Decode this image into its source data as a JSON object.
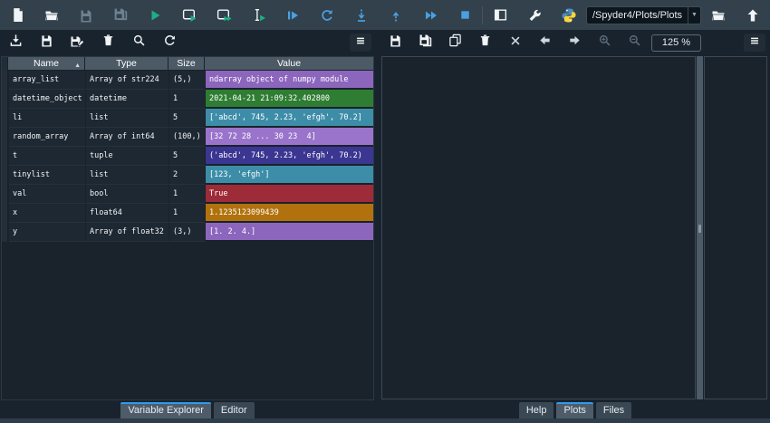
{
  "main_toolbar": {
    "buttons": [
      "new-file",
      "open-file",
      "save",
      "save-all",
      "run",
      "run-cell",
      "run-cell-advance",
      "run-selection",
      "debug-file",
      "rerun",
      "step-into",
      "step-return",
      "continue",
      "stop",
      "maximize-pane",
      "preferences",
      "python-interpreter",
      "open-directory",
      "parent-directory"
    ],
    "path_value": "/Spyder4/Plots/Plots",
    "dropdown_arrow": "▼"
  },
  "icons": {
    "new-file": "📄",
    "open-file": "📁",
    "save": "💾",
    "save-all": "💾",
    "run": "▶",
    "stop": "■",
    "search": "🔍",
    "refresh": "⟳",
    "menu": "☰",
    "trash": "🗑",
    "copy": "⧉",
    "close": "✕",
    "prev-plot": "←",
    "next-plot": "→",
    "zoom-in": "🔍+",
    "zoom-out": "🔍−",
    "import-data": "⤓",
    "up-arrow": "⬆",
    "wrench": "🔧",
    "python": "🐍"
  },
  "variable_explorer": {
    "toolbar": [
      "import-data",
      "save-data",
      "save-data-as",
      "remove-variables",
      "search",
      "refresh",
      "options-menu"
    ],
    "headers": {
      "name": "Name",
      "type": "Type",
      "size": "Size",
      "value": "Value"
    },
    "sort_indicator": "▲",
    "rows": [
      {
        "name": "array_list",
        "type": "Array of str224",
        "size": "(5,)",
        "value": "ndarray object of numpy module",
        "value_bg": "#8c66bd"
      },
      {
        "name": "datetime_object",
        "type": "datetime",
        "size": "1",
        "value": "2021-04-21 21:09:32.402800",
        "value_bg": "#2e7d32"
      },
      {
        "name": "li",
        "type": "list",
        "size": "5",
        "value": "['abcd', 745, 2.23, 'efgh', 70.2]",
        "value_bg": "#3d8da8"
      },
      {
        "name": "random_array",
        "type": "Array of int64",
        "size": "(100,)",
        "value": "[32 72 28 ... 30 23  4]",
        "value_bg": "#9a74ca"
      },
      {
        "name": "t",
        "type": "tuple",
        "size": "5",
        "value": "('abcd', 745, 2.23, 'efgh', 70.2)",
        "value_bg": "#3b3691"
      },
      {
        "name": "tinylist",
        "type": "list",
        "size": "2",
        "value": "[123, 'efgh']",
        "value_bg": "#3d8da8"
      },
      {
        "name": "val",
        "type": "bool",
        "size": "1",
        "value": "True",
        "value_bg": "#9e2b38"
      },
      {
        "name": "x",
        "type": "float64",
        "size": "1",
        "value": "1.1235123099439",
        "value_bg": "#b1720e"
      },
      {
        "name": "y",
        "type": "Array of float32",
        "size": "(3,)",
        "value": "[1. 2. 4.]",
        "value_bg": "#8c66bd"
      }
    ]
  },
  "plots": {
    "toolbar": [
      "save-plot",
      "save-all-plots",
      "copy-image",
      "remove-plot",
      "remove-all-plots",
      "previous-plot",
      "next-plot",
      "zoom-in",
      "zoom-out",
      "options-menu"
    ],
    "zoom_level": "125 %"
  },
  "tabs_left": {
    "items": [
      "Variable Explorer",
      "Editor"
    ],
    "active": "Variable Explorer"
  },
  "tabs_right": {
    "items": [
      "Help",
      "Plots",
      "Files"
    ],
    "active": "Plots"
  },
  "colors": {
    "accent_blue": "#2d9cf0",
    "icon_blue": "#4aa0e0",
    "run_green": "#1cae84",
    "toolbar_bg": "#32414B",
    "app_bg": "#19232D"
  }
}
